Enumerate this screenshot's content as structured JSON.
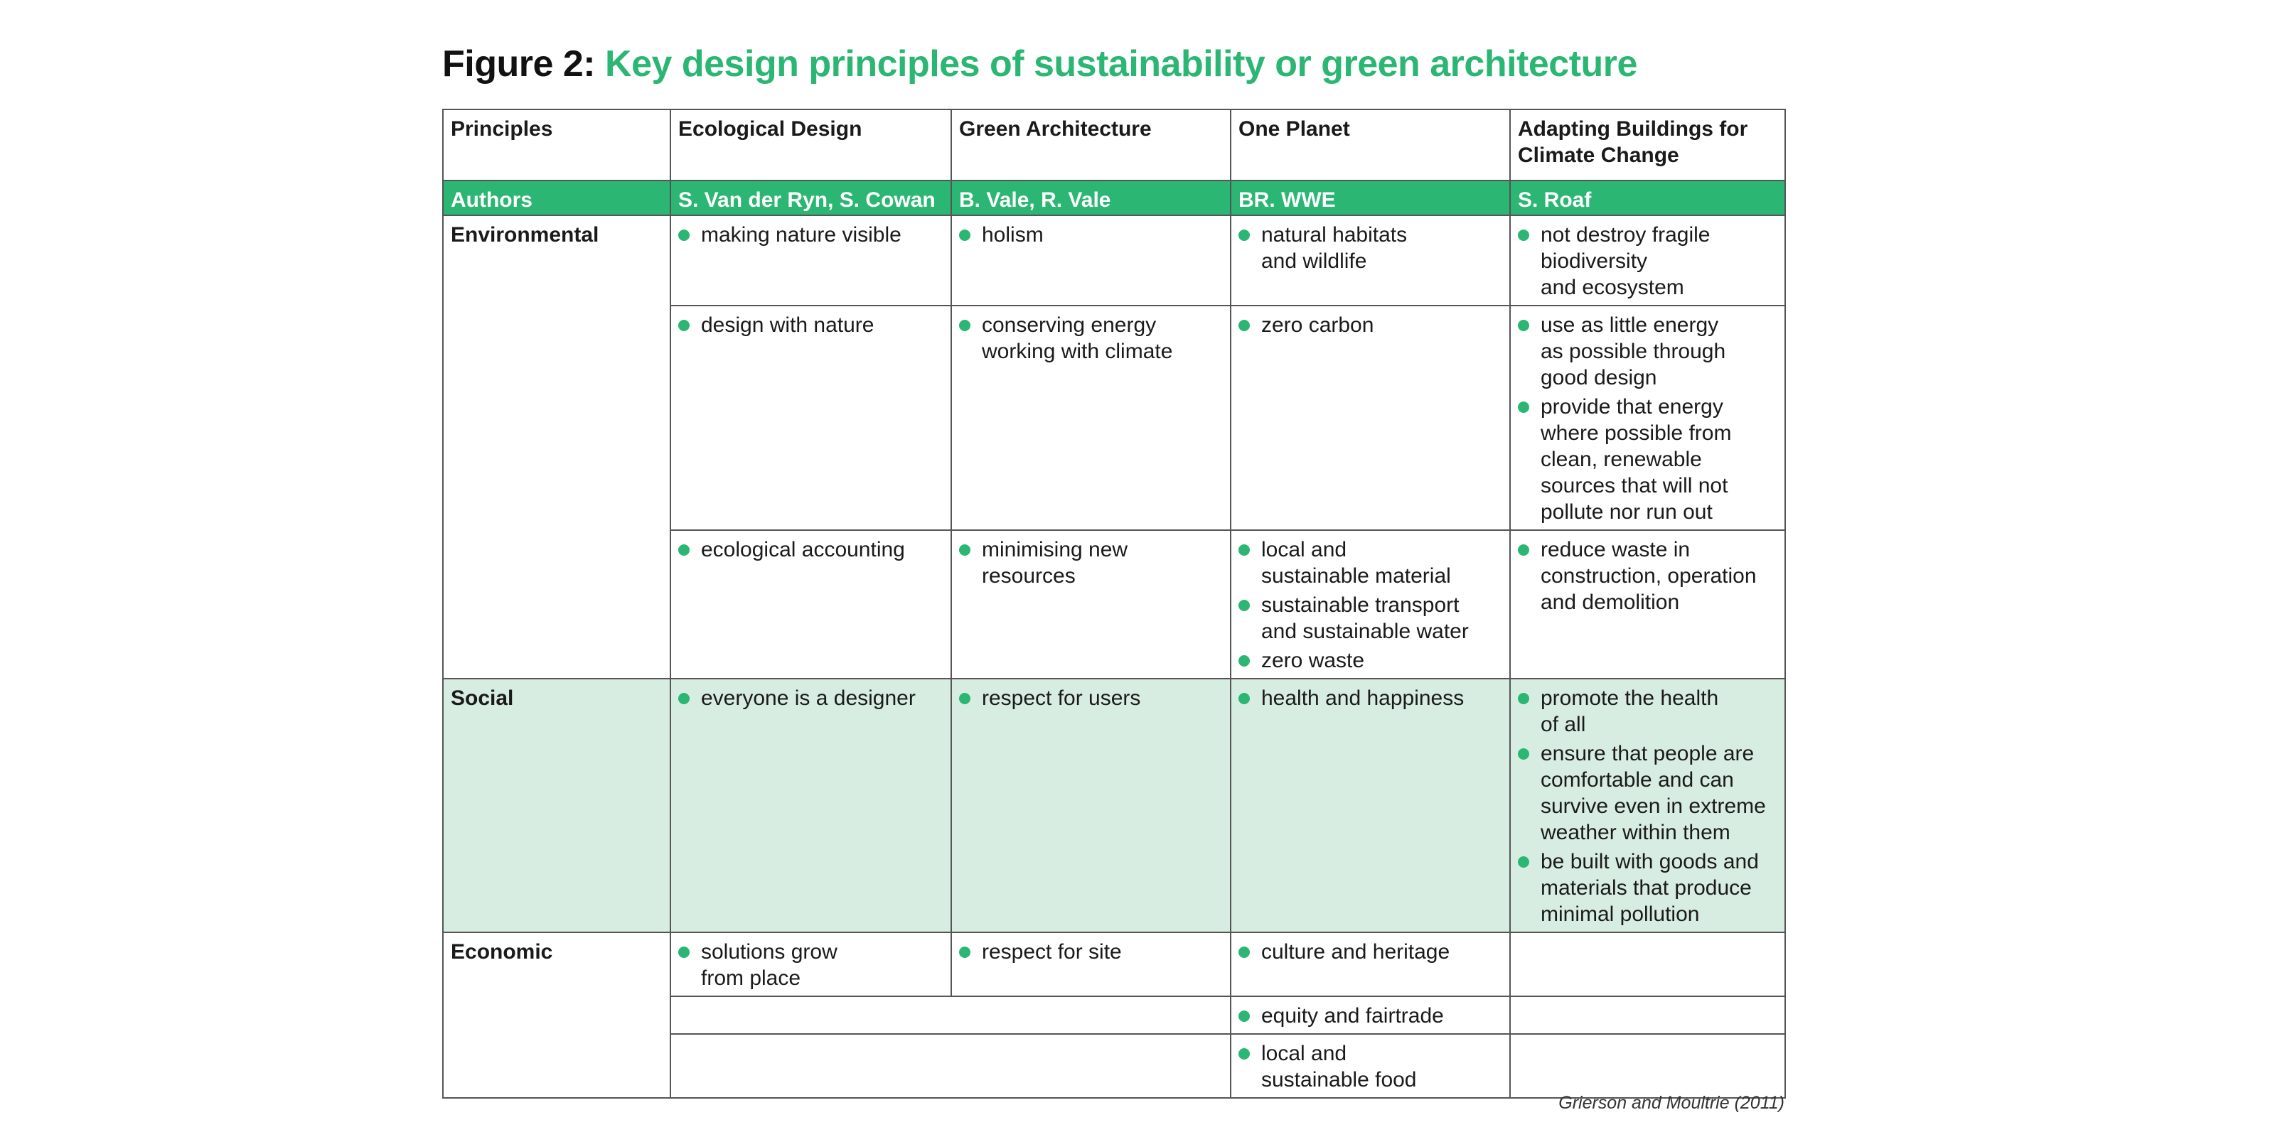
{
  "figure": {
    "label": "Figure 2:",
    "title": "Key design principles of sustainability or green architecture",
    "source": "Grierson and Moultrie (2011)"
  },
  "colors": {
    "accent": "#2bb673",
    "social_bg": "#d8ede1",
    "border": "#555555"
  },
  "header": [
    "Principles",
    "Ecological Design",
    "Green Architecture",
    "One Planet",
    "Adapting Buildings for Climate Change"
  ],
  "authors": [
    "Authors",
    "S. Van der Ryn, S. Cowan",
    "B. Vale, R. Vale",
    "BR. WWE",
    "S. Roaf"
  ],
  "rows": {
    "environmental": {
      "label": "Environmental",
      "r1": {
        "eco": [
          "making nature visible"
        ],
        "green": [
          "holism"
        ],
        "planet": [
          "natural habitats\nand wildlife"
        ],
        "adapt": [
          "not destroy fragile\nbiodiversity\nand ecosystem"
        ]
      },
      "r2": {
        "eco": [
          "design with nature"
        ],
        "green": [
          "conserving energy\nworking with climate"
        ],
        "planet": [
          "zero carbon"
        ],
        "adapt": [
          "use as little energy\nas possible through\ngood design",
          "provide that energy\nwhere possible from\nclean, renewable\nsources that will not\npollute nor run out"
        ]
      },
      "r3": {
        "eco": [
          "ecological accounting"
        ],
        "green": [
          "minimising new\nresources"
        ],
        "planet": [
          "local and\nsustainable material",
          "sustainable transport\nand sustainable water",
          "zero waste"
        ],
        "adapt": [
          "reduce waste in\nconstruction, operation\nand demolition"
        ]
      }
    },
    "social": {
      "label": "Social",
      "eco": [
        "everyone is a designer"
      ],
      "green": [
        "respect for users"
      ],
      "planet": [
        "health and happiness"
      ],
      "adapt": [
        "promote the health\nof all",
        "ensure that people are\ncomfortable and can\nsurvive even in extreme\nweather within them",
        "be built with goods and\nmaterials that produce\nminimal pollution"
      ]
    },
    "economic": {
      "label": "Economic",
      "r1": {
        "eco": [
          "solutions grow\nfrom place"
        ],
        "green": [
          "respect for site"
        ],
        "planet": [
          "culture and heritage"
        ],
        "adapt": []
      },
      "r2": {
        "planet": [
          "equity and fairtrade"
        ],
        "adapt": []
      },
      "r3": {
        "planet": [
          "local and\nsustainable food"
        ],
        "adapt": []
      }
    }
  }
}
